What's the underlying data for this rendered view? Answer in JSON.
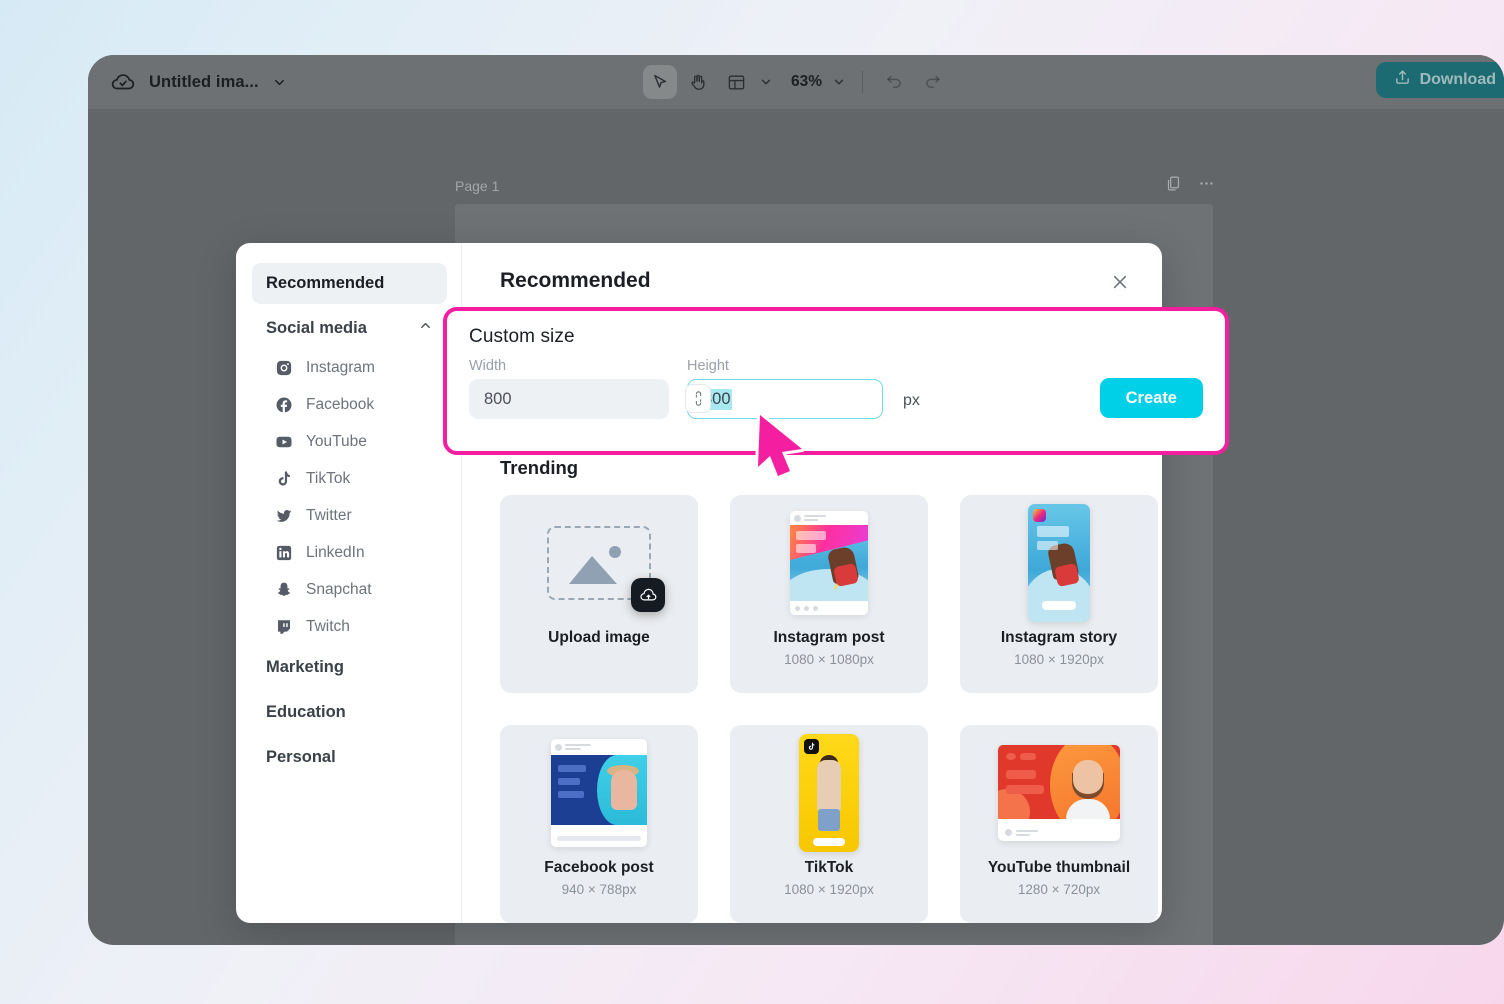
{
  "app": {
    "logo_icon": "cloud-check-icon",
    "doc_title": "Untitled ima...",
    "title_caret_icon": "chevron-down-icon",
    "toolbar": {
      "select_icon": "cursor-arrow-icon",
      "hand_icon": "hand-icon",
      "layout_icon": "layout-panel-icon",
      "layout_caret_icon": "chevron-down-icon",
      "zoom_level": "63%",
      "zoom_caret_icon": "chevron-down-icon",
      "undo_icon": "undo-arrow-icon",
      "redo_icon": "redo-arrow-icon"
    },
    "download": {
      "label": "Download",
      "icon": "upload-tray-icon",
      "color": "#1d6b72"
    }
  },
  "canvas": {
    "page_label": "Page 1",
    "duplicate_icon": "duplicate-page-icon",
    "more_icon": "more-horizontal-icon"
  },
  "modal": {
    "title": "Recommended",
    "close_icon": "close-x-icon",
    "sidebar": {
      "selected": "Recommended",
      "social_media": {
        "label": "Social media",
        "caret_icon": "chevron-up-icon"
      },
      "social_items": [
        {
          "label": "Instagram",
          "icon": "instagram-icon"
        },
        {
          "label": "Facebook",
          "icon": "facebook-icon"
        },
        {
          "label": "YouTube",
          "icon": "youtube-icon"
        },
        {
          "label": "TikTok",
          "icon": "tiktok-icon"
        },
        {
          "label": "Twitter",
          "icon": "twitter-icon"
        },
        {
          "label": "LinkedIn",
          "icon": "linkedin-icon"
        },
        {
          "label": "Snapchat",
          "icon": "snapchat-icon"
        },
        {
          "label": "Twitch",
          "icon": "twitch-icon"
        }
      ],
      "groups": [
        {
          "label": "Marketing"
        },
        {
          "label": "Education"
        },
        {
          "label": "Personal"
        }
      ]
    },
    "custom_size": {
      "title": "Custom size",
      "width_label": "Width",
      "width_value": "800",
      "height_label": "Height",
      "height_value": "800",
      "link_icon": "chain-link-icon",
      "unit": "px",
      "create_label": "Create",
      "create_color": "#00cfe8",
      "highlight_color": "#f31fa0"
    },
    "trending": {
      "title": "Trending",
      "cards": [
        {
          "name": "Upload image",
          "dim": "",
          "thumb": "upload-placeholder"
        },
        {
          "name": "Instagram post",
          "dim": "1080 × 1080px",
          "thumb": "instagram-post-preview"
        },
        {
          "name": "Instagram story",
          "dim": "1080 × 1920px",
          "thumb": "instagram-story-preview"
        },
        {
          "name": "Facebook post",
          "dim": "940 × 788px",
          "thumb": "facebook-post-preview"
        },
        {
          "name": "TikTok",
          "dim": "1080 × 1920px",
          "thumb": "tiktok-preview"
        },
        {
          "name": "YouTube thumbnail",
          "dim": "1280 × 720px",
          "thumb": "youtube-thumbnail-preview"
        }
      ]
    }
  },
  "cursor": {
    "icon": "mouse-pointer-icon",
    "color": "#f31fa0"
  }
}
